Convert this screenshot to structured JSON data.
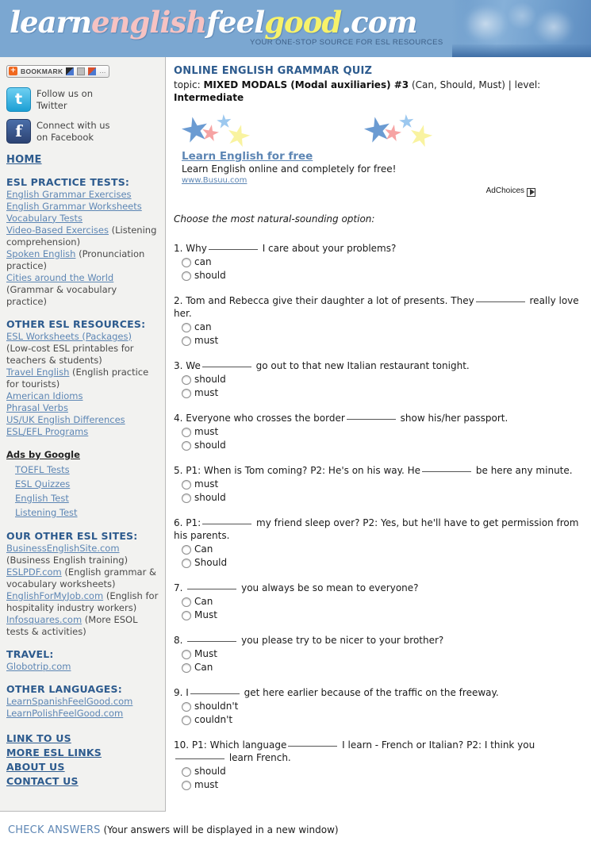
{
  "site": {
    "logo_parts": [
      "learn",
      "english",
      "feel",
      "good",
      ".com"
    ],
    "tagline": "YOUR ONE-STOP SOURCE FOR ESL RESOURCES",
    "header_bg": "#7ba7d1",
    "heading_color": "#2d5b8e",
    "link_color": "#5d86b4"
  },
  "sidebar": {
    "bookmark": {
      "label": "BOOKMARK",
      "plus": "+",
      "dots": "…"
    },
    "social": [
      {
        "icon": "twitter-icon",
        "glyph": "t",
        "line1": "Follow us on",
        "line2": "Twitter"
      },
      {
        "icon": "facebook-icon",
        "glyph": "f",
        "line1": "Connect with us",
        "line2": "on Facebook"
      }
    ],
    "home_label": "HOME",
    "sections": [
      {
        "title": "ESL PRACTICE TESTS:",
        "items": [
          {
            "label": "English Grammar Exercises",
            "note": ""
          },
          {
            "label": "English Grammar Worksheets",
            "note": ""
          },
          {
            "label": "Vocabulary Tests",
            "note": ""
          },
          {
            "label": "Video-Based Exercises",
            "note": " (Listening comprehension)"
          },
          {
            "label": "Spoken English",
            "note": " (Pronunciation practice)"
          },
          {
            "label": "Cities around the World",
            "note": " (Grammar & vocabulary practice)"
          }
        ]
      },
      {
        "title": "OTHER ESL RESOURCES:",
        "items": [
          {
            "label": "ESL Worksheets (Packages)",
            "note": " (Low-cost ESL printables for teachers & students)"
          },
          {
            "label": "Travel English",
            "note": " (English practice for tourists)"
          },
          {
            "label": "American Idioms",
            "note": ""
          },
          {
            "label": "Phrasal Verbs",
            "note": ""
          },
          {
            "label": "US/UK English Differences",
            "note": ""
          },
          {
            "label": "ESL/EFL Programs",
            "note": ""
          }
        ]
      }
    ],
    "ads_by_google": {
      "title": "Ads by Google",
      "items": [
        "TOEFL Tests",
        "ESL Quizzes",
        "English Test",
        "Listening Test"
      ]
    },
    "other_sites": {
      "title": "OUR OTHER ESL SITES:",
      "items": [
        {
          "label": "BusinessEnglishSite.com",
          "note": "(Business English training)"
        },
        {
          "label": "ESLPDF.com",
          "note": " (English grammar & vocabulary worksheets)"
        },
        {
          "label": "EnglishForMyJob.com",
          "note": " (English for hospitality industry workers)"
        },
        {
          "label": "Infosquares.com",
          "note": " (More ESOL tests & activities)"
        }
      ]
    },
    "travel": {
      "title": "TRAVEL:",
      "items": [
        "Globotrip.com"
      ]
    },
    "languages": {
      "title": "OTHER LANGUAGES:",
      "items": [
        "LearnSpanishFeelGood.com",
        "LearnPolishFeelGood.com"
      ]
    },
    "bottom_links": [
      "LINK TO US",
      "MORE ESL LINKS",
      "ABOUT US",
      "CONTACT US"
    ]
  },
  "main": {
    "title": "ONLINE ENGLISH GRAMMAR QUIZ",
    "topic_prefix": "topic: ",
    "topic_bold": "MIXED MODALS (Modal auxiliaries) #3",
    "topic_rest": " (Can, Should, Must) | level: ",
    "level_bold": "Intermediate",
    "ad": {
      "title": "Learn English for free",
      "description": "Learn English online and completely for free!",
      "url": "www.Busuu.com",
      "adchoices": "AdChoices"
    },
    "instructions": "Choose the most natural-sounding option:",
    "questions": [
      {
        "number": "1.",
        "parts": [
          "Why",
          "I care about your problems?"
        ],
        "options": [
          "can",
          "should"
        ]
      },
      {
        "number": "2.",
        "parts": [
          "Tom and Rebecca give their daughter a lot of presents. They",
          "really love her."
        ],
        "options": [
          "can",
          "must"
        ]
      },
      {
        "number": "3.",
        "parts": [
          "We",
          "go out to that new Italian restaurant tonight."
        ],
        "options": [
          "should",
          "must"
        ]
      },
      {
        "number": "4.",
        "parts": [
          "Everyone who crosses the border",
          "show his/her passport."
        ],
        "options": [
          "must",
          "should"
        ]
      },
      {
        "number": "5.",
        "parts": [
          "P1: When is Tom coming? P2: He's on his way. He",
          "be here any minute."
        ],
        "options": [
          "must",
          "should"
        ]
      },
      {
        "number": "6.",
        "parts": [
          "P1:",
          "my friend sleep over? P2: Yes, but he'll have to get permission from his parents."
        ],
        "options": [
          "Can",
          "Should"
        ]
      },
      {
        "number": "7.",
        "parts": [
          "",
          "you always be so mean to everyone?"
        ],
        "options": [
          "Can",
          "Must"
        ]
      },
      {
        "number": "8.",
        "parts": [
          "",
          "you please try to be nicer to your brother?"
        ],
        "options": [
          "Must",
          "Can"
        ]
      },
      {
        "number": "9.",
        "parts": [
          "I",
          "get here earlier because of the traffic on the freeway."
        ],
        "options": [
          "shouldn't",
          "couldn't"
        ]
      },
      {
        "number": "10.",
        "parts": [
          "P1: Which language",
          "I learn - French or Italian? P2: I think you",
          "learn French."
        ],
        "options": [
          "should",
          "must"
        ]
      }
    ],
    "check_answers_label": "CHECK ANSWERS",
    "check_answers_note": " (Your answers will be displayed in a new window)"
  }
}
